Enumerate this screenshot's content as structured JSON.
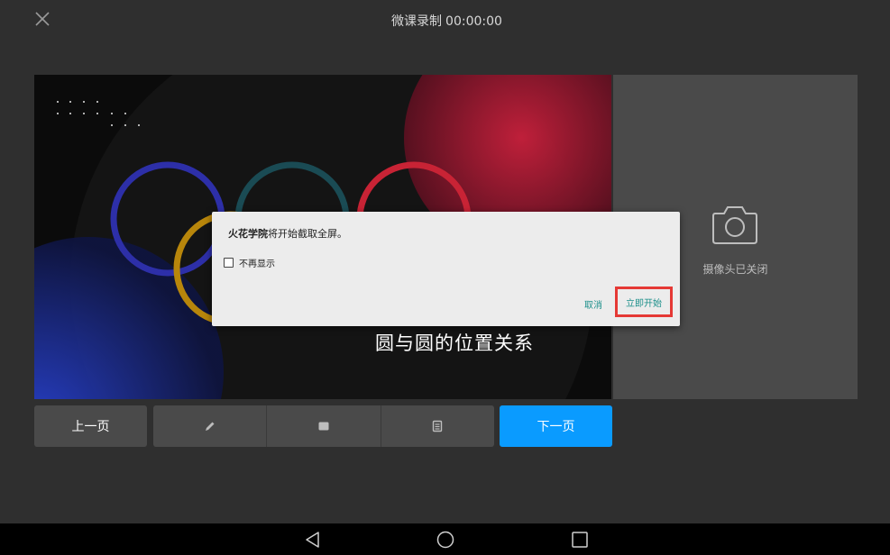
{
  "header": {
    "title": "微课录制",
    "timer": "00:00:00"
  },
  "slide": {
    "title": "圆与圆的位置关系"
  },
  "camera": {
    "status_text": "摄像头已关闭"
  },
  "controls": {
    "prev_label": "上一页",
    "next_label": "下一页",
    "tools": [
      "pen-icon",
      "square-icon",
      "document-icon"
    ]
  },
  "dialog": {
    "app_name": "火花学院",
    "message": "将开始截取全屏。",
    "checkbox_label": "不再显示",
    "checkbox_checked": false,
    "cancel_label": "取消",
    "confirm_label": "立即开始"
  },
  "colors": {
    "accent": "#0a9bff",
    "dialog_button_text": "#1b8f8a",
    "highlight_border": "#e53935"
  }
}
